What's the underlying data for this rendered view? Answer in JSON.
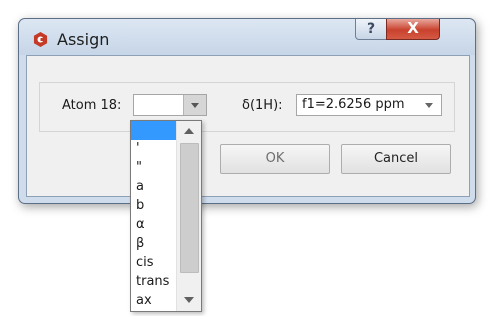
{
  "window": {
    "title": "Assign",
    "help_glyph": "?",
    "close_glyph": "X",
    "app_icon": "red-hexagon-logo-icon",
    "accent_color": "#c43a27"
  },
  "form": {
    "atom_label": "Atom 18:",
    "atom_value": "",
    "shift_label": "δ(1H):",
    "shift_value": "f1=2.6256 ppm"
  },
  "buttons": {
    "ok_label": "OK",
    "cancel_label": "Cancel"
  },
  "dropdown": {
    "items": [
      "",
      "'",
      "\"",
      "a",
      "b",
      "α",
      "β",
      "cis",
      "trans",
      "ax"
    ],
    "selected_index": 0,
    "selection_color": "#3399ff"
  }
}
